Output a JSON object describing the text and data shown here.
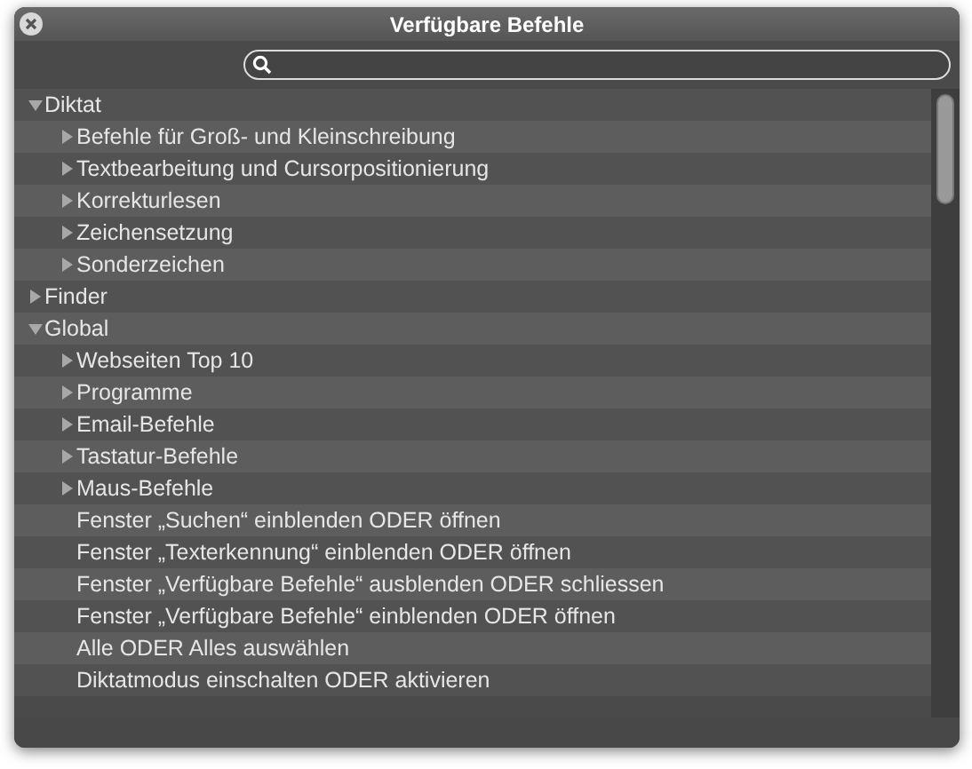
{
  "window": {
    "title": "Verfügbare Befehle"
  },
  "tree": [
    {
      "label": "Diktat",
      "expanded": true,
      "children": [
        {
          "label": "Befehle für Groß- und Kleinschreibung",
          "expanded": false
        },
        {
          "label": "Textbearbeitung und Cursorpositionierung",
          "expanded": false
        },
        {
          "label": "Korrekturlesen",
          "expanded": false
        },
        {
          "label": "Zeichensetzung",
          "expanded": false
        },
        {
          "label": "Sonderzeichen",
          "expanded": false
        }
      ]
    },
    {
      "label": "Finder",
      "expanded": false
    },
    {
      "label": "Global",
      "expanded": true,
      "children": [
        {
          "label": "Webseiten Top 10",
          "expanded": false
        },
        {
          "label": "Programme",
          "expanded": false
        },
        {
          "label": "Email-Befehle",
          "expanded": false
        },
        {
          "label": "Tastatur-Befehle",
          "expanded": false
        },
        {
          "label": "Maus-Befehle",
          "expanded": false
        },
        {
          "label": "Fenster „Suchen“ einblenden ODER öffnen",
          "kind": "leaf"
        },
        {
          "label": "Fenster „Texterkennung“ einblenden ODER öffnen",
          "kind": "leaf"
        },
        {
          "label": "Fenster „Verfügbare Befehle“ ausblenden ODER schliessen",
          "kind": "leaf"
        },
        {
          "label": "Fenster „Verfügbare Befehle“ einblenden ODER öffnen",
          "kind": "leaf"
        },
        {
          "label": "Alle ODER Alles auswählen",
          "kind": "leaf"
        },
        {
          "label": "Diktatmodus einschalten ODER aktivieren",
          "kind": "leaf"
        }
      ]
    }
  ]
}
